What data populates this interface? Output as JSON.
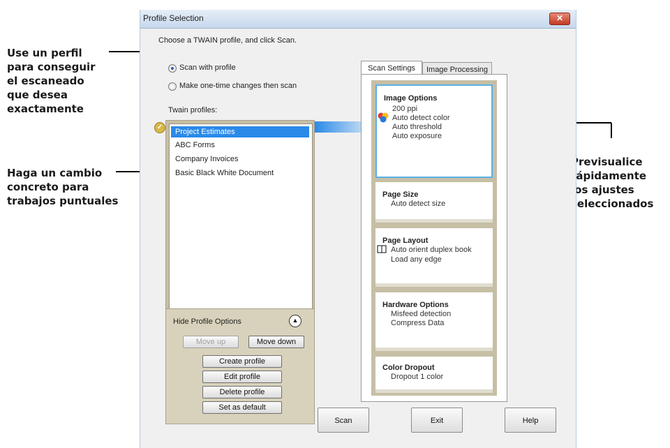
{
  "annotations": {
    "use_profile": "Use un perfil\npara conseguir\nel escaneado\nque desea\nexactamente",
    "one_time": "Haga un cambio\nconcreto para\ntrabajos puntuales",
    "preview": "Previsualice\nrápidamente\nlos ajustes\nseleccionados"
  },
  "dialog": {
    "title": "Profile Selection",
    "close_label": "✕",
    "instruction": "Choose a TWAIN profile, and click Scan.",
    "radio_profile": "Scan with profile",
    "radio_onetime": "Make one-time changes then scan",
    "profiles_label": "Twain profiles:",
    "profiles": [
      "Project Estimates",
      "ABC Forms",
      "Company Invoices",
      "Basic Black White Document"
    ],
    "selected_profile_index": 0,
    "options": {
      "hide_label": "Hide Profile Options",
      "move_up": "Move up",
      "move_down": "Move down",
      "create": "Create profile",
      "edit": "Edit profile",
      "delete": "Delete profile",
      "set_default": "Set as default"
    },
    "tabs": [
      "Scan Settings",
      "Image Processing"
    ],
    "cards": {
      "image_options": {
        "title": "Image Options",
        "lines": [
          "200 ppi",
          "Auto detect color",
          "Auto threshold",
          "Auto exposure"
        ]
      },
      "page_size": {
        "title": "Page Size",
        "lines": [
          "Auto detect size"
        ]
      },
      "page_layout": {
        "title": "Page Layout",
        "lines": [
          "Auto orient duplex book",
          "Load any edge"
        ]
      },
      "hardware_options": {
        "title": "Hardware Options",
        "lines": [
          "Misfeed detection",
          "Compress Data"
        ]
      },
      "color_dropout": {
        "title": "Color Dropout",
        "lines": [
          "Dropout 1 color"
        ]
      }
    },
    "buttons": {
      "scan": "Scan",
      "exit": "Exit",
      "help": "Help"
    }
  }
}
